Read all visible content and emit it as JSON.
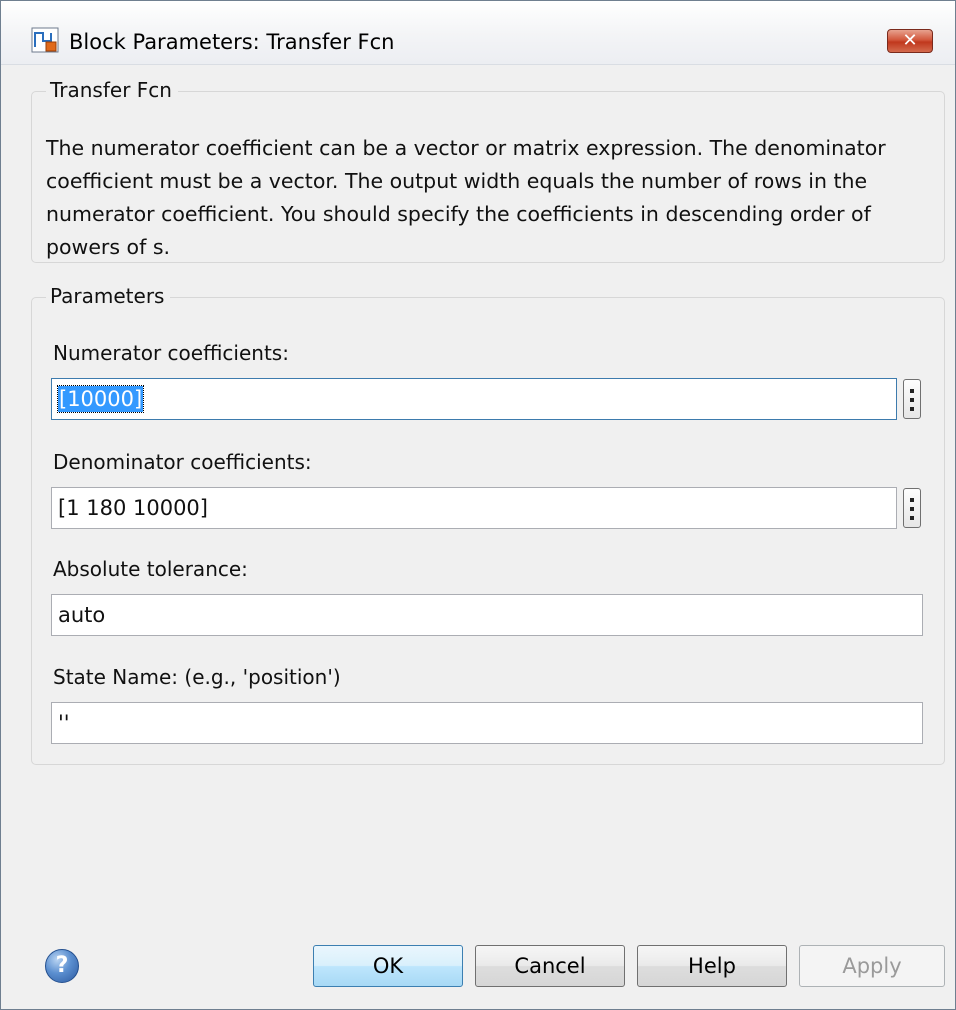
{
  "window": {
    "title": "Block Parameters: Transfer Fcn",
    "close_glyph": "✕"
  },
  "block_group": {
    "legend": "Transfer Fcn",
    "description": "The numerator coefficient can be a vector or matrix expression. The denominator coefficient must be a vector. The output width equals the number of rows in the numerator coefficient. You should specify the coefficients in descending order of powers of s."
  },
  "parameters": {
    "legend": "Parameters",
    "numerator": {
      "label": "Numerator coefficients:",
      "value": "[10000]"
    },
    "denominator": {
      "label": "Denominator coefficients:",
      "value": "[1 180 10000]"
    },
    "abs_tolerance": {
      "label": "Absolute tolerance:",
      "value": "auto"
    },
    "state_name": {
      "label": "State Name: (e.g., 'position')",
      "value": "''"
    }
  },
  "buttons": {
    "help_glyph": "?",
    "ok": "OK",
    "cancel": "Cancel",
    "help": "Help",
    "apply": "Apply"
  },
  "colors": {
    "selection": "#3399ff",
    "default_button": "#bee6fd",
    "close_button": "#c0381d"
  },
  "icons": {
    "app": "simulink-block-icon",
    "more": "vertical-ellipsis-icon",
    "help": "question-circle-icon"
  }
}
